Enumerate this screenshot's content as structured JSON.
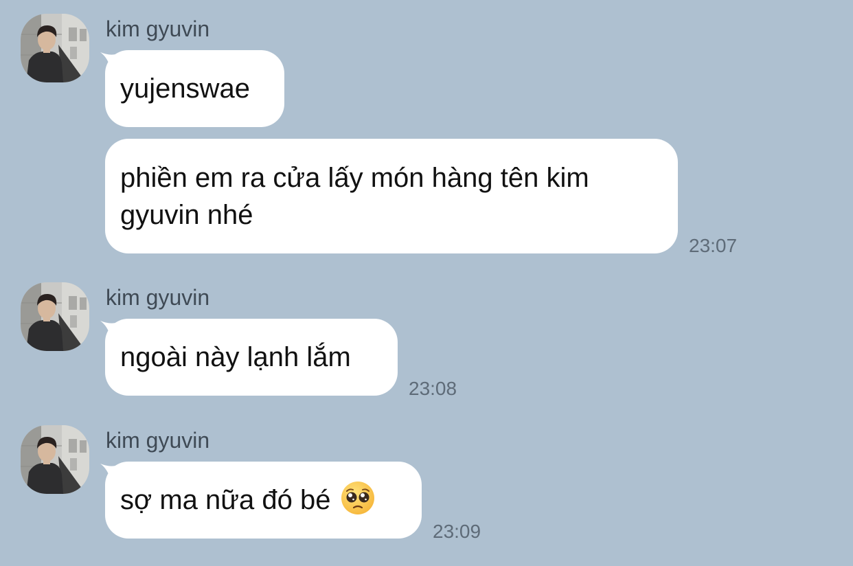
{
  "theme": {
    "background": "#aec0d0",
    "bubble_color": "#ffffff",
    "sender_color": "#3f4a55",
    "time_color": "#5e6b78"
  },
  "messages": [
    {
      "sender": "kim gyuvin",
      "bubbles": [
        {
          "text": "yujenswae"
        },
        {
          "text": "phiền em ra cửa lấy món hàng tên kim gyuvin nhé"
        }
      ],
      "time": "23:07"
    },
    {
      "sender": "kim gyuvin",
      "bubbles": [
        {
          "text": "ngoài này lạnh lắm"
        }
      ],
      "time": "23:08"
    },
    {
      "sender": "kim gyuvin",
      "bubbles": [
        {
          "text": "sợ ma nữa đó bé",
          "emoji": "pleading-face-emoji"
        }
      ],
      "time": "23:09"
    }
  ]
}
